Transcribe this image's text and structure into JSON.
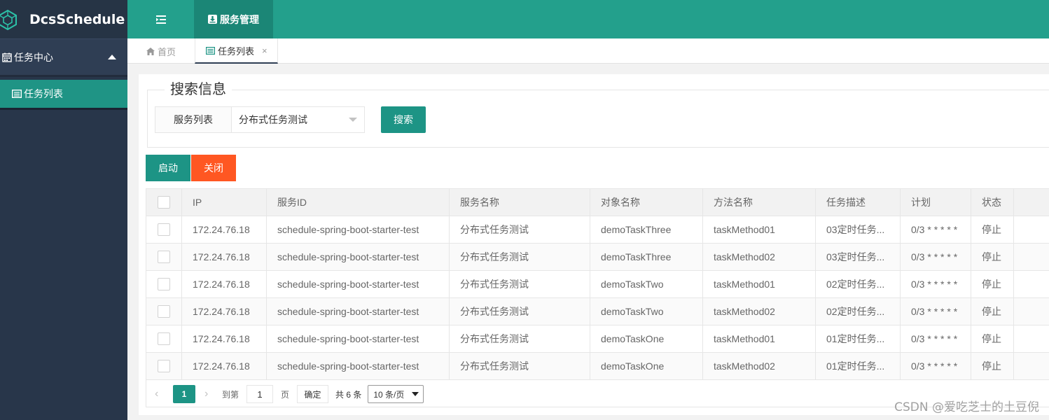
{
  "app": {
    "title": "DcsSchedule"
  },
  "sidebar": {
    "group_label": "任务中心",
    "items": [
      {
        "label": "任务列表",
        "active": true
      }
    ]
  },
  "header": {
    "tab_label": "服务管理"
  },
  "page_tabs": [
    {
      "label": "首页"
    },
    {
      "label": "任务列表",
      "close": "×"
    }
  ],
  "search": {
    "legend": "搜索信息",
    "select_label": "服务列表",
    "select_value": "分布式任务测试",
    "button": "搜索"
  },
  "actions": {
    "start": "启动",
    "stop": "关闭"
  },
  "table": {
    "columns": [
      "IP",
      "服务ID",
      "服务名称",
      "对象名称",
      "方法名称",
      "任务描述",
      "计划",
      "状态"
    ],
    "rows": [
      [
        "172.24.76.18",
        "schedule-spring-boot-starter-test",
        "分布式任务测试",
        "demoTaskThree",
        "taskMethod01",
        "03定时任务...",
        "0/3 * * * * *",
        "停止"
      ],
      [
        "172.24.76.18",
        "schedule-spring-boot-starter-test",
        "分布式任务测试",
        "demoTaskThree",
        "taskMethod02",
        "03定时任务...",
        "0/3 * * * * *",
        "停止"
      ],
      [
        "172.24.76.18",
        "schedule-spring-boot-starter-test",
        "分布式任务测试",
        "demoTaskTwo",
        "taskMethod01",
        "02定时任务...",
        "0/3 * * * * *",
        "停止"
      ],
      [
        "172.24.76.18",
        "schedule-spring-boot-starter-test",
        "分布式任务测试",
        "demoTaskTwo",
        "taskMethod02",
        "02定时任务...",
        "0/3 * * * * *",
        "停止"
      ],
      [
        "172.24.76.18",
        "schedule-spring-boot-starter-test",
        "分布式任务测试",
        "demoTaskOne",
        "taskMethod01",
        "01定时任务...",
        "0/3 * * * * *",
        "停止"
      ],
      [
        "172.24.76.18",
        "schedule-spring-boot-starter-test",
        "分布式任务测试",
        "demoTaskOne",
        "taskMethod02",
        "01定时任务...",
        "0/3 * * * * *",
        "停止"
      ]
    ]
  },
  "pager": {
    "prev": "‹",
    "current": "1",
    "next": "›",
    "goto_label": "到第",
    "goto_value": "1",
    "page_label": "页",
    "confirm": "确定",
    "total": "共 6 条",
    "page_size": "10 条/页"
  },
  "watermark": "CSDN @爱吃芝士的土豆倪",
  "colors": {
    "header": "#23a08c",
    "sidebar": "#28364a",
    "primary": "#1d9485",
    "danger": "#ff5722"
  }
}
